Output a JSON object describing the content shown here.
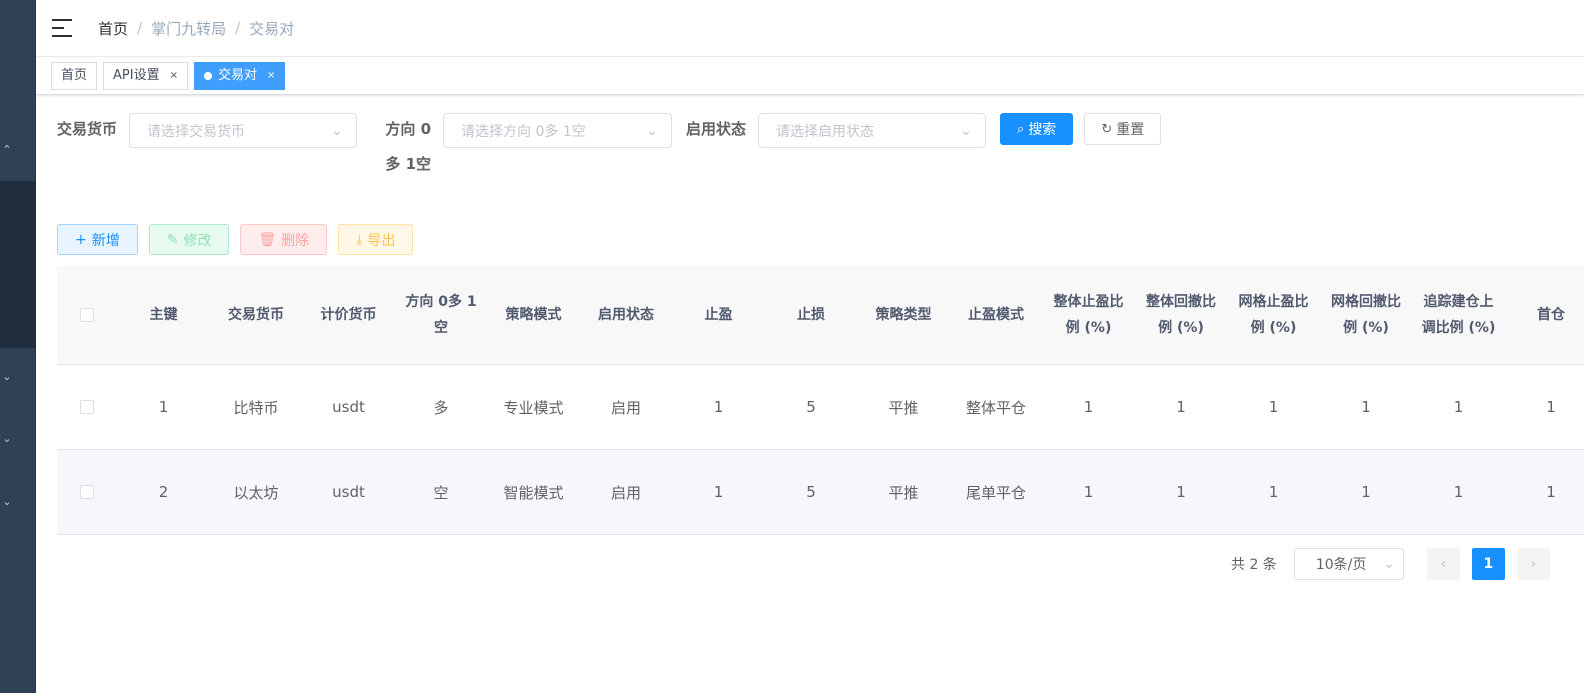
{
  "breadcrumb": [
    "首页",
    "掌门九转局",
    "交易对"
  ],
  "breadcrumb_separator": "/",
  "tags": [
    {
      "label": "首页",
      "closable": false,
      "active": false
    },
    {
      "label": "API设置",
      "closable": true,
      "active": false
    },
    {
      "label": "交易对",
      "closable": true,
      "active": true
    }
  ],
  "tag_close": "×",
  "filters": {
    "currency_label": "交易货币",
    "currency_placeholder": "请选择交易货币",
    "direction_label": "方向 0多 1空",
    "direction_placeholder": "请选择方向 0多  1空",
    "status_label": "启用状态",
    "status_placeholder": "请选择启用状态",
    "search_label": "搜索",
    "reset_label": "重置"
  },
  "actions": {
    "add": "新增",
    "edit": "修改",
    "delete": "删除",
    "export": "导出"
  },
  "table": {
    "columns": [
      "主键",
      "交易货币",
      "计价货币",
      "方向 0多 1空",
      "策略模式",
      "启用状态",
      "止盈",
      "止损",
      "策略类型",
      "止盈模式",
      "整体止盈比例 (%)",
      "整体回撤比例 (%)",
      "网格止盈比例 (%)",
      "网格回撤比例 (%)",
      "追踪建仓上调比例 (%)",
      "首仓"
    ],
    "rows": [
      [
        "1",
        "比特币",
        "usdt",
        "多",
        "专业模式",
        "启用",
        "1",
        "5",
        "平推",
        "整体平仓",
        "1",
        "1",
        "1",
        "1",
        "1",
        "1"
      ],
      [
        "2",
        "以太坊",
        "usdt",
        "空",
        "智能模式",
        "启用",
        "1",
        "5",
        "平推",
        "尾单平仓",
        "1",
        "1",
        "1",
        "1",
        "1",
        "1"
      ]
    ]
  },
  "pagination": {
    "total": "共 2 条",
    "page_size": "10条/页",
    "current_page": "1"
  },
  "colors": {
    "primary": "#1890ff",
    "sidebar": "#304156",
    "tag_active": "#409eff"
  }
}
